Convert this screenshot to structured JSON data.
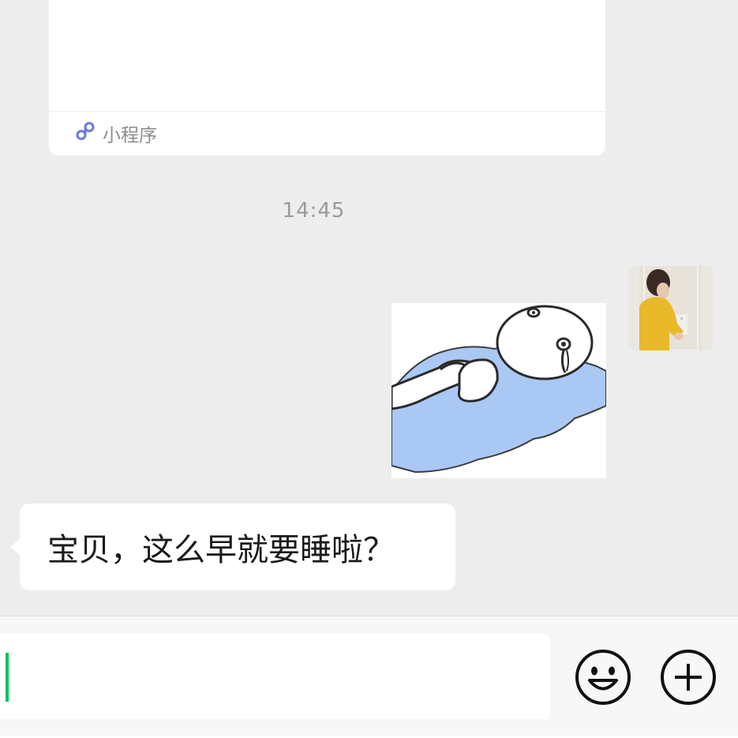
{
  "mini_program_card": {
    "footer_label": "小程序",
    "icon": "mini-program-icon"
  },
  "timestamp": "14:45",
  "self_message": {
    "type": "sticker",
    "sticker": "crying-figure-lying-in-puddle-sticker"
  },
  "incoming_message": {
    "text": "宝贝，这么早就要睡啦？"
  },
  "input_bar": {
    "value": "",
    "emoji_icon": "emoji-icon",
    "more_icon": "plus-icon"
  },
  "colors": {
    "background": "#ededed",
    "bubble": "#ffffff",
    "caret": "#07c160",
    "timestamp": "#9a9a9a"
  }
}
